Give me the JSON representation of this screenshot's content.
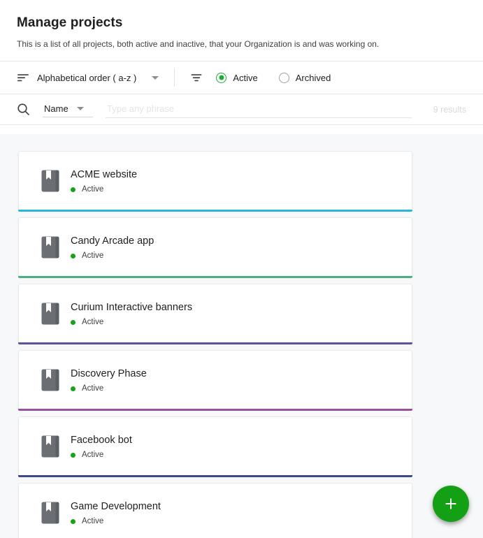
{
  "header": {
    "title": "Manage projects",
    "subtitle": "This is a list of all projects, both active and inactive, that your Organization is and was working on."
  },
  "toolbar": {
    "sort_icon": "sort-descending-icon",
    "sort_label": "Alphabetical order ( a-z )",
    "sort_caret": "chevron-down-icon",
    "filter_icon": "filter-icon",
    "options": [
      {
        "label": "Active",
        "selected": true
      },
      {
        "label": "Archived",
        "selected": false
      }
    ]
  },
  "search": {
    "icon": "search-icon",
    "field_label": "Name",
    "field_caret": "chevron-down-icon",
    "value": "",
    "placeholder": "Type any phrase",
    "results_count": "9 results"
  },
  "colors": {
    "accent_green": "#14a014",
    "status_green": "#16a31a",
    "radio_green": "#1faa35",
    "list_background": "#f7f8f9",
    "card_background": "#ffffff",
    "text_primary": "#202124",
    "text_muted": "#3c4043",
    "placeholder": "#e3e5e8"
  },
  "projects": [
    {
      "name": "ACME website",
      "status": "Active",
      "accent": "#29b6d8",
      "icon": "project-book-icon"
    },
    {
      "name": "Candy Arcade app",
      "status": "Active",
      "accent": "#4caf7d",
      "icon": "project-book-icon"
    },
    {
      "name": "Curium Interactive banners",
      "status": "Active",
      "accent": "#5e52a0",
      "icon": "project-book-icon"
    },
    {
      "name": "Discovery Phase",
      "status": "Active",
      "accent": "#9c4f9c",
      "icon": "project-book-icon"
    },
    {
      "name": "Facebook bot",
      "status": "Active",
      "accent": "#3f4a8a",
      "icon": "project-book-icon"
    },
    {
      "name": "Game Development",
      "status": "Active",
      "accent": "#d8dade",
      "icon": "project-book-icon"
    }
  ],
  "fab": {
    "icon": "plus-icon",
    "label": "Add project"
  }
}
